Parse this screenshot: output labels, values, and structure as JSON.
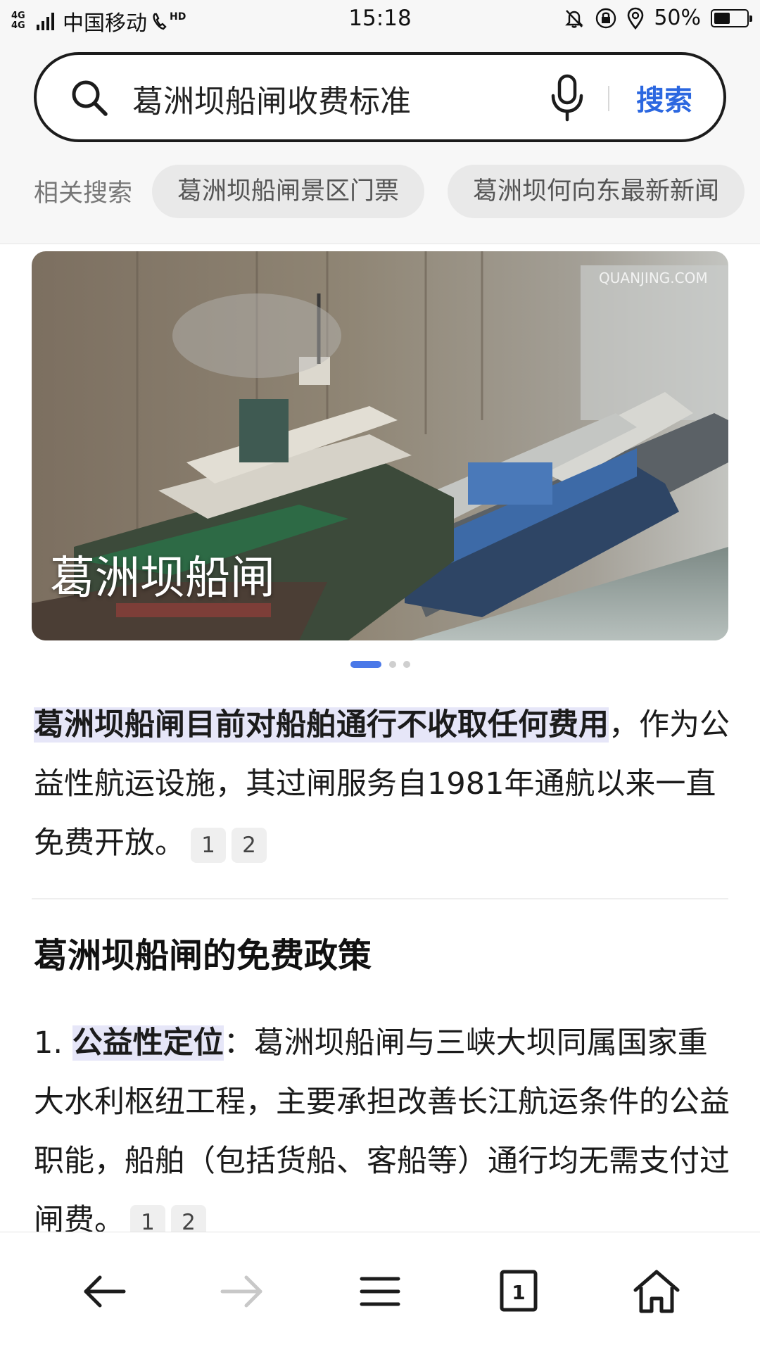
{
  "status_bar": {
    "network": "4G 4G",
    "carrier": "中国移动",
    "hd_label": "HD",
    "time": "15:18",
    "battery_percent": "50%",
    "battery_level": 0.5,
    "icons": [
      "signal-icon",
      "hd-call-icon",
      "mute-bell-icon",
      "rotation-lock-icon",
      "location-icon",
      "battery-icon"
    ]
  },
  "search": {
    "query": "葛洲坝船闸收费标准",
    "button_label": "搜索"
  },
  "related": {
    "label": "相关搜索",
    "chips": [
      "葛洲坝船闸景区门票",
      "葛洲坝何向东最新新闻"
    ]
  },
  "hero": {
    "title": "葛洲坝船闸",
    "watermark": "QUANJING.COM",
    "slide_count": 3,
    "active_slide": 1
  },
  "answer": {
    "highlight": "葛洲坝船闸目前对船舶通行不收取任何费用",
    "rest": "，作为公益性航运设施，其过闸服务自1981年通航以来一直免费开放。",
    "refs": [
      "1",
      "2"
    ]
  },
  "section": {
    "heading": "葛洲坝船闸的免费政策"
  },
  "list_item_1": {
    "number": "1.",
    "title": "公益性定位",
    "colon": "：",
    "text": "葛洲坝船闸与三峡大坝同属国家重大水利枢纽工程，主要承担改善长江航运条件的公益职能，船舶（包括货船、客船等）通行均无需支付过闸费。",
    "refs": [
      "1",
      "2"
    ]
  },
  "bottom_nav": {
    "tab_count": "1",
    "icons": [
      "back-arrow-icon",
      "forward-arrow-icon",
      "menu-icon",
      "tabs-icon",
      "home-icon"
    ]
  },
  "colors": {
    "accent": "#2b67e0",
    "highlight": "#e6e6f8",
    "active_dot": "#4a78e8"
  }
}
